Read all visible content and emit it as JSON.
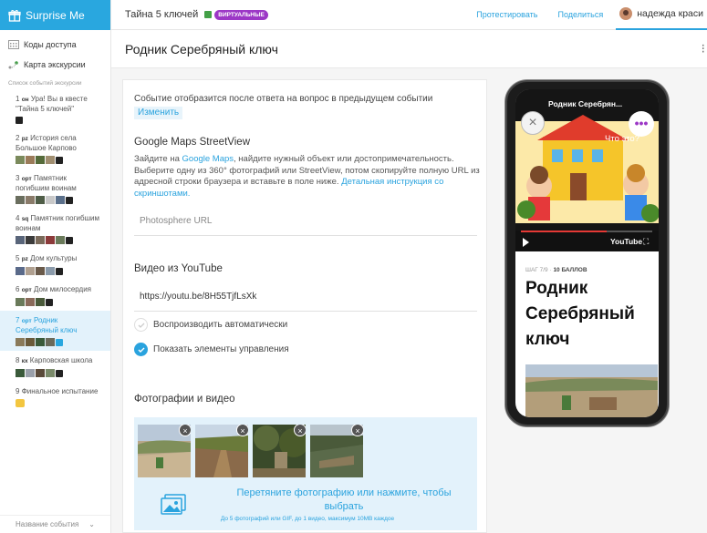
{
  "app": {
    "brand": "Surprise Me"
  },
  "sidebar": {
    "links": [
      {
        "label": "Коды доступа",
        "icon": "keypad-icon"
      },
      {
        "label": "Карта экскурсии",
        "icon": "map-route-icon"
      }
    ],
    "caption": "Список событий экскурсии",
    "events": [
      {
        "num": "1",
        "code": "он",
        "title": "Ура! Вы в квесте \"Тайна 5 ключей\""
      },
      {
        "num": "2",
        "code": "рz",
        "title": "История села Большое Карпово"
      },
      {
        "num": "3",
        "code": "орт",
        "title": "Памятник погибшим воинам"
      },
      {
        "num": "4",
        "code": "sq",
        "title": "Памятник погибшим воинам"
      },
      {
        "num": "5",
        "code": "рz",
        "title": "Дом культуры"
      },
      {
        "num": "6",
        "code": "орт",
        "title": "Дом милосердия"
      },
      {
        "num": "7",
        "code": "орт",
        "title": "Родник Серебряный ключ"
      },
      {
        "num": "8",
        "code": "кх",
        "title": "Карповская школа"
      },
      {
        "num": "9",
        "code": "",
        "title": "Финальное испытание"
      }
    ],
    "bottom_label": "Название события"
  },
  "topbar": {
    "quest_title": "Тайна 5 ключей",
    "badge": "ВИРТУАЛЬНЫЕ",
    "test_link": "Протестировать",
    "share_link": "Поделиться",
    "user_name": "надежда краси"
  },
  "main": {
    "title": "Родник Серебряный ключ",
    "more_icon": "vertical-dots-icon"
  },
  "form": {
    "notice": "Событие отобразится после ответа на вопрос в предыдущем событии",
    "change_link": "Изменить",
    "streetview_heading": "Google Maps StreetView",
    "streetview_desc_1": "Зайдите на ",
    "streetview_desc_link": "Google Maps",
    "streetview_desc_2": ", найдите нужный объект или достопримечательность. Выберите одну из 360° фотографий или StreetView, потом скопируйте полную URL из адресной строки браузера и вставьте в поле ниже. ",
    "streetview_desc_link2": "Детальная инструкция со скриншотами.",
    "photosphere_placeholder": "Photosphere URL",
    "youtube_heading": "Видео из YouTube",
    "youtube_url": "https://youtu.be/8H55TjfLsXk",
    "autoplay_label": "Воспроизводить автоматически",
    "autoplay_checked": false,
    "controls_label": "Показать элементы управления",
    "controls_checked": true,
    "media_heading": "Фотографии и видео",
    "photos_count": 4,
    "drop_text": "Перетяните фотографию или нажмите, чтобы выбрать",
    "drop_subtext": "До 5 фотографий или GIF, до 1 видео, максимум 10MB каждое"
  },
  "preview": {
    "video_title": "Родник Серебрян...",
    "video_caption": "Что это?",
    "youtube_label": "YouTube",
    "step_label": "ШАГ 7/9",
    "points_label": "10 БАЛЛОВ",
    "event_title": "Родник Серебряный ключ",
    "accent": "#9c37c6"
  },
  "colors": {
    "brand": "#29a7df",
    "link": "#2aa3de",
    "badge": "#9c37c6",
    "highlight": "#e3f2fb"
  }
}
